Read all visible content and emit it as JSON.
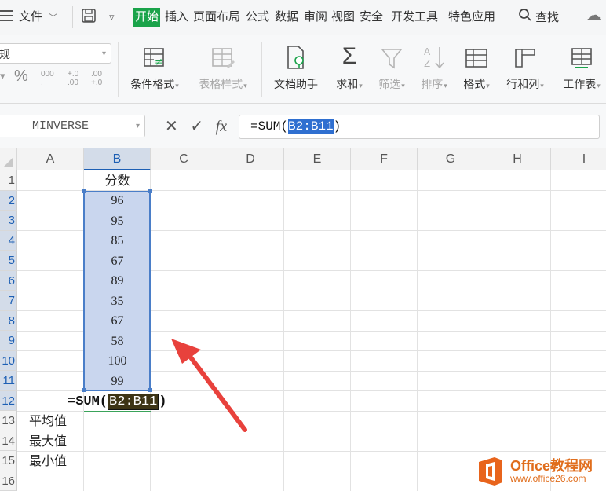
{
  "menubar": {
    "file": "文件",
    "tabs": [
      "开始",
      "插入",
      "页面布局",
      "公式",
      "数据",
      "审阅",
      "视图",
      "安全",
      "开发工具",
      "特色应用"
    ],
    "active_tab": "开始",
    "search": "查找"
  },
  "ribbon": {
    "number_format": "规",
    "percent": "%",
    "thousands": "000",
    "inc_decimal": "+.0 .00",
    "dec_decimal": ".00 +.0",
    "conditional_format": "条件格式",
    "table_style": "表格样式",
    "doc_assistant": "文档助手",
    "sum": "求和",
    "filter": "筛选",
    "sort": "排序",
    "format": "格式",
    "row_col": "行和列",
    "worksheet": "工作表"
  },
  "formula_bar": {
    "name_box": "MINVERSE",
    "fx": "fx",
    "formula_prefix": "=SUM(",
    "formula_ref": "B2:B11",
    "formula_suffix": ")"
  },
  "sheet": {
    "columns": [
      "A",
      "B",
      "C",
      "D",
      "E",
      "F",
      "G",
      "H",
      "I"
    ],
    "rows": [
      "1",
      "2",
      "3",
      "4",
      "5",
      "6",
      "7",
      "8",
      "9",
      "10",
      "11",
      "12",
      "13",
      "14",
      "15",
      "16"
    ],
    "b1": "分数",
    "scores": [
      "96",
      "95",
      "85",
      "67",
      "89",
      "35",
      "67",
      "58",
      "100",
      "99"
    ],
    "edit_prefix": "=SUM(",
    "edit_ref": "B2:B11",
    "edit_suffix": ")",
    "a13": "平均值",
    "a14": "最大值",
    "a15": "最小值"
  },
  "watermark": {
    "title": "Office教程网",
    "url": "www.office26.com"
  },
  "colors": {
    "active_tab": "#1aa34a",
    "selection_fill": "#c9d6ee",
    "selection_border": "#4a7ec8",
    "arrow": "#e8413c"
  }
}
